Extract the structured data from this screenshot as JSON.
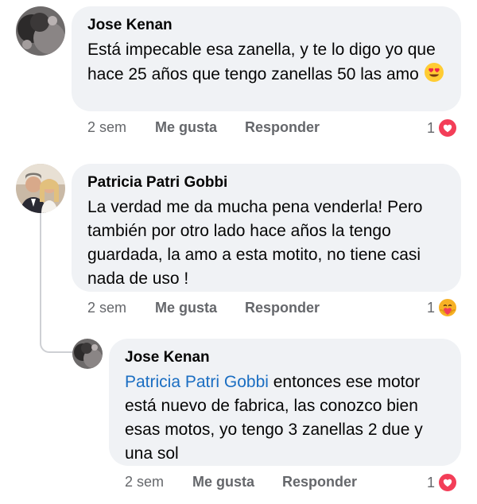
{
  "comments": [
    {
      "author": "Jose Kenan",
      "text": "Está impecable esa zanella, y te lo digo yo que hace 25 años que tengo zanellas 50 las amo",
      "emoji": "heart-eyes-emoji",
      "time": "2 sem",
      "like_label": "Me gusta",
      "reply_label": "Responder",
      "reaction_count": "1",
      "reaction_icon": "love-reaction-icon"
    },
    {
      "author": "Patricia Patri Gobbi",
      "text": "La verdad me da mucha pena venderla! Pero también por otro lado hace años la tengo guardada, la amo a esta motito, no tiene casi nada de uso !",
      "time": "2 sem",
      "like_label": "Me gusta",
      "reply_label": "Responder",
      "reaction_count": "1",
      "reaction_icon": "care-reaction-icon"
    }
  ],
  "reply": {
    "author": "Jose Kenan",
    "mention": "Patricia Patri Gobbi",
    "text": " entonces ese motor está nuevo de fabrica, las conozco bien esas motos, yo tengo 3 zanellas 2 due y una sol",
    "time": "2 sem",
    "like_label": "Me gusta",
    "reply_label": "Responder",
    "reaction_count": "1",
    "reaction_icon": "love-reaction-icon"
  },
  "colors": {
    "bubble_bg": "#f0f2f5",
    "meta_text": "#65676b",
    "mention": "#1b6ec2",
    "love_red": "#f33e58"
  }
}
